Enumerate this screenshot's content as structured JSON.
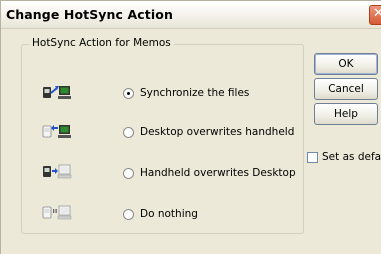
{
  "window": {
    "title": "Change HotSync Action"
  },
  "group": {
    "label": "HotSync Action for Memos"
  },
  "options": [
    {
      "label": "Synchronize the files",
      "selected": true,
      "icon": "handheld-to-desktop-sync-icon"
    },
    {
      "label": "Desktop overwrites handheld",
      "selected": false,
      "icon": "desktop-to-handheld-icon"
    },
    {
      "label": "Handheld overwrites Desktop",
      "selected": false,
      "icon": "handheld-to-desktop-icon"
    },
    {
      "label": "Do nothing",
      "selected": false,
      "icon": "do-nothing-icon"
    }
  ],
  "buttons": {
    "ok": "OK",
    "cancel": "Cancel",
    "help": "Help"
  },
  "set_default": {
    "label": "Set as default",
    "checked": false
  },
  "colors": {
    "title_bg": "#f4f2ea",
    "dialog_bg": "#ece9d8",
    "close_button": "#d55a36",
    "arrow_blue": "#2255cc",
    "screen_green": "#2e8b2e"
  }
}
